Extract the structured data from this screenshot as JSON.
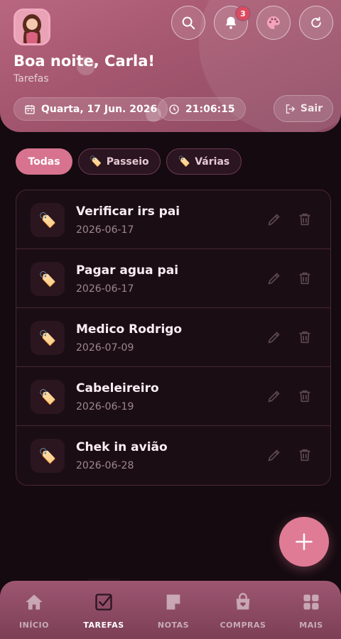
{
  "header": {
    "greeting": "Boa noite, Carla!",
    "subtitle": "Tarefas",
    "notifications_count": "3",
    "date": "Quarta, 17 Jun. 2026",
    "time": "21:06:15",
    "logout_label": "Sair",
    "icons": [
      "search-icon",
      "bell-icon",
      "palette-icon",
      "refresh-icon"
    ]
  },
  "filters": [
    {
      "label": "Todas",
      "active": true
    },
    {
      "label": "Passeio",
      "active": false,
      "icon": "tag-icon"
    },
    {
      "label": "Várias",
      "active": false,
      "icon": "tag-icon"
    }
  ],
  "tasks": [
    {
      "title": "Verificar irs pai",
      "date": "2026-06-17"
    },
    {
      "title": "Pagar agua pai",
      "date": "2026-06-17"
    },
    {
      "title": "Medico Rodrigo",
      "date": "2026-07-09"
    },
    {
      "title": "Cabeleireiro",
      "date": "2026-06-19"
    },
    {
      "title": "Chek in avião",
      "date": "2026-06-28"
    }
  ],
  "nav": [
    {
      "label": "INÍCIO",
      "icon": "home-icon"
    },
    {
      "label": "TAREFAS",
      "icon": "checkbox-icon",
      "active": true
    },
    {
      "label": "NOTAS",
      "icon": "note-icon"
    },
    {
      "label": "COMPRAS",
      "icon": "shopping-bag-icon"
    },
    {
      "label": "MAIS",
      "icon": "grid-icon"
    }
  ],
  "colors": {
    "accent": "#d8738f",
    "background": "#140a0f",
    "badge": "#e04a5e"
  }
}
